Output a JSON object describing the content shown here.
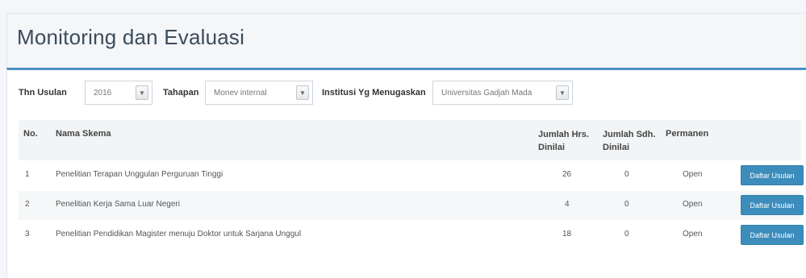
{
  "page": {
    "title": "Monitoring dan Evaluasi"
  },
  "filters": {
    "tahun_label": "Thn Usulan",
    "tahun_value": "2016",
    "tahapan_label": "Tahapan",
    "tahapan_value": "Monev internal",
    "institusi_label": "Institusi Yg Menugaskan",
    "institusi_value": "Universitas Gadjah Mada"
  },
  "table": {
    "headers": {
      "no": "No.",
      "nama": "Nama Skema",
      "jumlah_line1": "Jumlah Hrs.",
      "jumlah_line2": "Dinilai",
      "sudah_line1": "Jumlah Sdh.",
      "sudah_line2": "Dinilai",
      "permanen": "Permanen"
    },
    "rows": [
      {
        "no": "1",
        "nama": "Penelitian Terapan Unggulan Perguruan Tinggi",
        "jumlah": "26",
        "sudah": "0",
        "permanen": "Open",
        "action": "Daftar Usulan"
      },
      {
        "no": "2",
        "nama": "Penelitian Kerja Sama Luar Negeri",
        "jumlah": "4",
        "sudah": "0",
        "permanen": "Open",
        "action": "Daftar Usulan"
      },
      {
        "no": "3",
        "nama": "Penelitian Pendidikan Magister menuju Doktor untuk Sarjana Unggul",
        "jumlah": "18",
        "sudah": "0",
        "permanen": "Open",
        "action": "Daftar Usulan"
      }
    ]
  },
  "colors": {
    "accent": "#4a90c8",
    "button": "#3c8dbc"
  },
  "icons": {
    "select_arrow": "chevron-down-icon"
  }
}
